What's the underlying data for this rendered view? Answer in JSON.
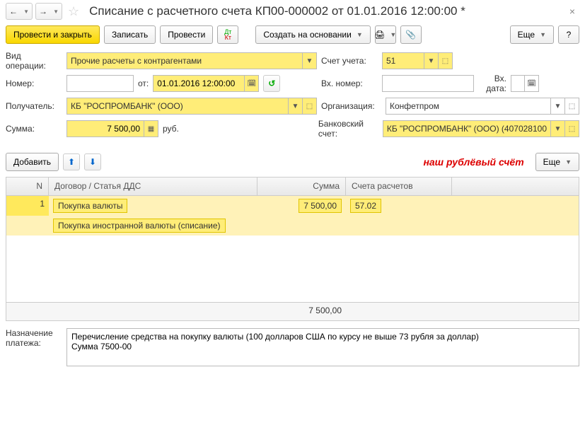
{
  "title": "Списание с расчетного счета КП00-000002 от 01.01.2016 12:00:00 *",
  "toolbar": {
    "post_close": "Провести и закрыть",
    "save": "Записать",
    "post": "Провести",
    "create_based": "Создать на основании",
    "more": "Еще"
  },
  "labels": {
    "op_type": "Вид операции:",
    "account": "Счет учета:",
    "number": "Номер:",
    "from": "от:",
    "ext_number": "Вх. номер:",
    "ext_date": "Вх. дата:",
    "recipient": "Получатель:",
    "org": "Организация:",
    "sum": "Сумма:",
    "bank_acc": "Банковский счет:",
    "currency": "руб.",
    "add": "Добавить",
    "purpose": "Назначение платежа:"
  },
  "values": {
    "op_type": "Прочие расчеты с контрагентами",
    "account": "51",
    "number": "",
    "date": "01.01.2016 12:00:00",
    "ext_number": "",
    "ext_date": "",
    "recipient": "КБ \"РОСПРОМБАНК\" (ООО)",
    "org": "Конфетпром",
    "sum": "7 500,00",
    "bank_acc": "КБ \"РОСПРОМБАНК\" (ООО) (407028100",
    "purpose": "Перечисление средства на покупку валюты (100 долларов США по курсу не выше 73 рубля за доллар)\nСумма 7500-00"
  },
  "annotation": "наш рублёвый счёт",
  "grid": {
    "headers": {
      "n": "N",
      "contract": "Договор / Статья ДДС",
      "sum": "Сумма",
      "accounts": "Счета расчетов"
    },
    "rows": [
      {
        "n": "1",
        "contract1": "Покупка валюты",
        "sum": "7 500,00",
        "acc": "57.02",
        "contract2": "Покупка иностранной валюты (списание)"
      }
    ],
    "total": "7 500,00"
  }
}
